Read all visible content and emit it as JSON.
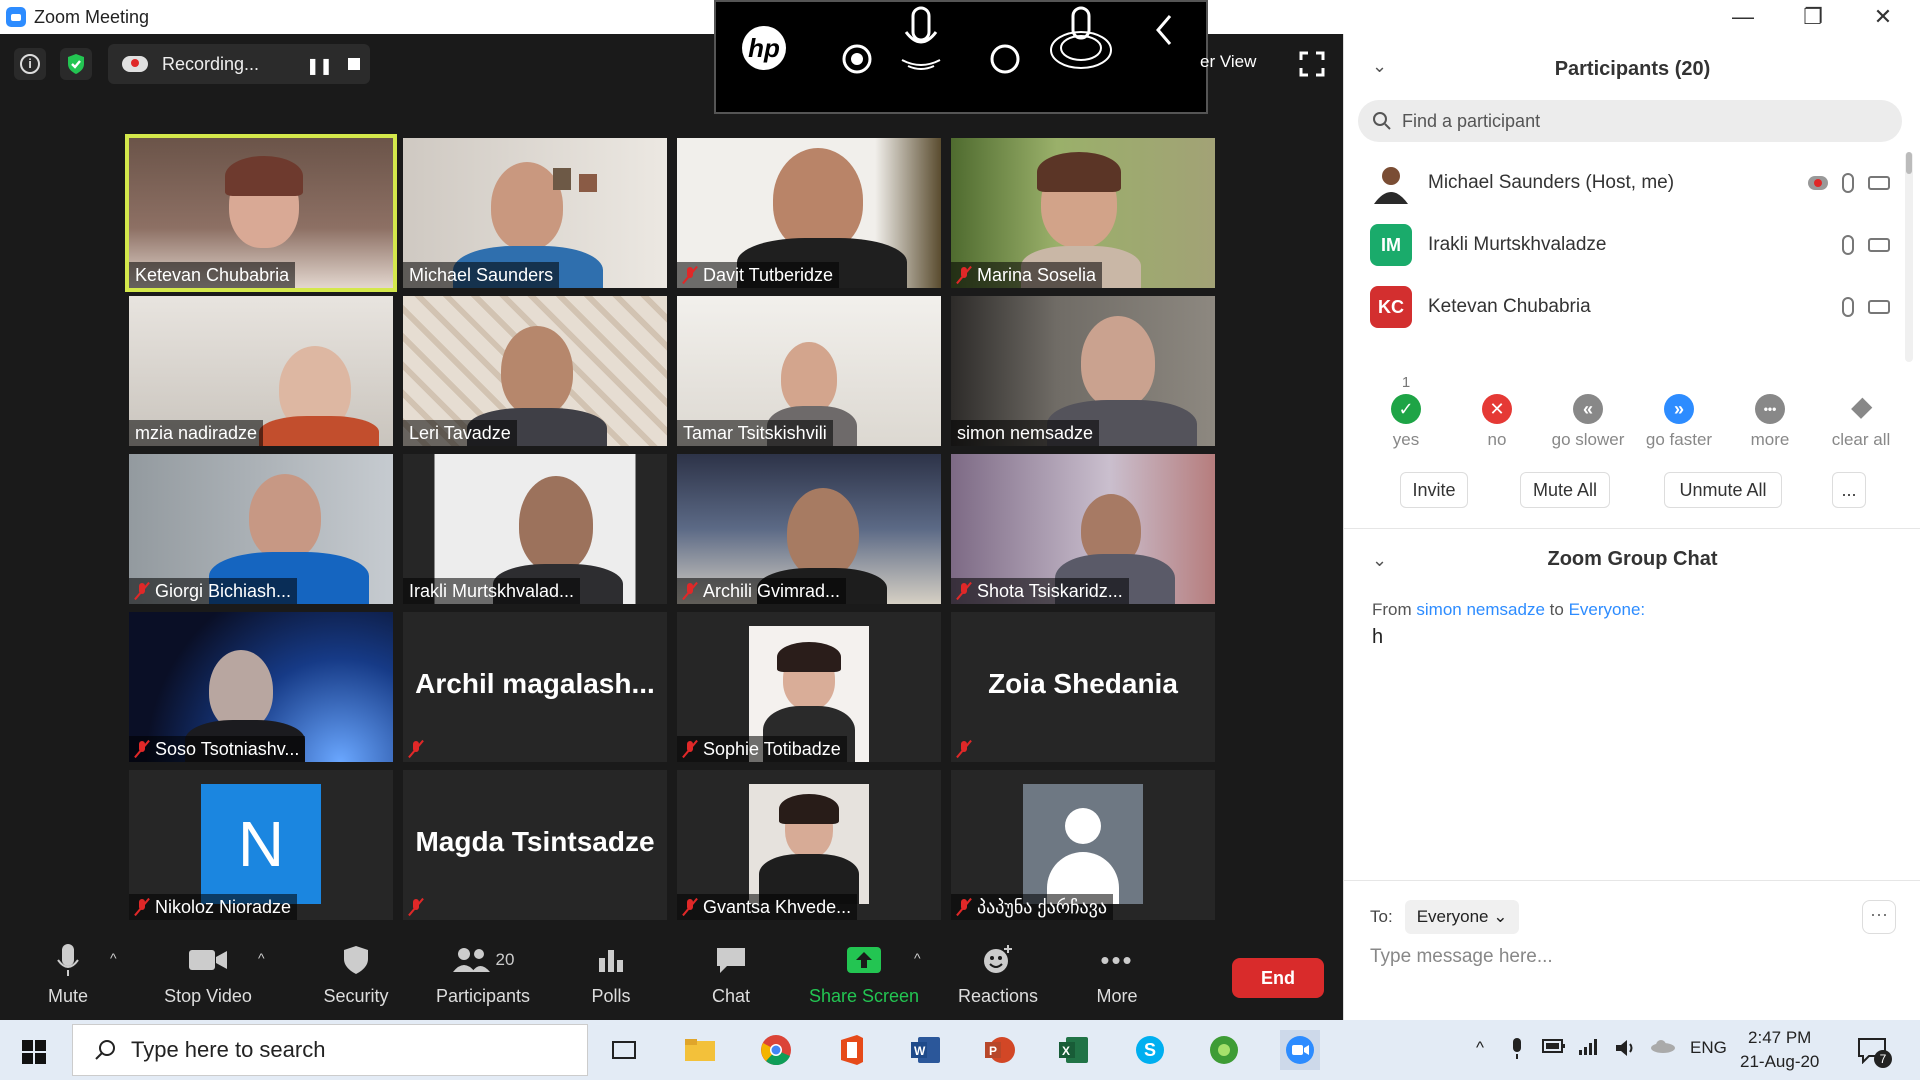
{
  "window": {
    "title": "Zoom Meeting"
  },
  "topbar": {
    "recording_label": "Recording...",
    "view_label": "er View",
    "hp_logo": "hp"
  },
  "tiles": [
    {
      "name": "Ketevan Chubabria"
    },
    {
      "name": "Michael Saunders"
    },
    {
      "name": "Davit Tutberidze"
    },
    {
      "name": "Marina Soselia"
    },
    {
      "name": "mzia nadiradze"
    },
    {
      "name": "Leri Tavadze"
    },
    {
      "name": "Tamar Tsitskishvili"
    },
    {
      "name": "simon nemsadze"
    },
    {
      "name": "Giorgi Bichiash..."
    },
    {
      "name": "Irakli Murtskhvalad..."
    },
    {
      "name": "Archili Gvimrad..."
    },
    {
      "name": "Shota Tsiskaridz..."
    },
    {
      "name": "Soso Tsotniashv..."
    },
    {
      "name": "Archil  magalash..."
    },
    {
      "name": "Sophie Totibadze"
    },
    {
      "name": "Zoia Shedania"
    },
    {
      "name": "Nikoloz Nioradze",
      "initial": "N"
    },
    {
      "name": "Magda Tsintsadze"
    },
    {
      "name": "Gvantsa Khvede..."
    },
    {
      "name": "პაპუნა ქარჩავა"
    }
  ],
  "toolbar": {
    "mute": "Mute",
    "stop_video": "Stop Video",
    "security": "Security",
    "participants": "Participants",
    "participants_count": "20",
    "polls": "Polls",
    "chat": "Chat",
    "share_screen": "Share Screen",
    "reactions": "Reactions",
    "more": "More",
    "end": "End"
  },
  "panel": {
    "title": "Participants (20)",
    "search_placeholder": "Find a participant",
    "participants": [
      {
        "name": "Michael Saunders (Host, me)",
        "initials": ""
      },
      {
        "name": "Irakli Murtskhvaladze",
        "initials": "IM",
        "color": "#1aab6b"
      },
      {
        "name": "Ketevan Chubabria",
        "initials": "KC",
        "color": "#d32f2f"
      }
    ],
    "reactions": [
      {
        "label": "yes",
        "count": "1",
        "color": "#1ea446",
        "icon": "✓"
      },
      {
        "label": "no",
        "count": "",
        "color": "#e53935",
        "icon": "✕"
      },
      {
        "label": "go slower",
        "count": "",
        "color": "#888888",
        "icon": "«"
      },
      {
        "label": "go faster",
        "count": "",
        "color": "#2d8cff",
        "icon": "»"
      },
      {
        "label": "more",
        "count": "",
        "color": "#888888",
        "icon": "•••"
      },
      {
        "label": "clear all",
        "count": "",
        "color": "#888888",
        "icon": ""
      }
    ],
    "buttons": {
      "invite": "Invite",
      "mute_all": "Mute All",
      "unmute_all": "Unmute All",
      "more": "..."
    },
    "chat": {
      "title": "Zoom Group Chat",
      "from_prefix": "From",
      "from_name": "simon nemsadze",
      "to_word": "to",
      "to_name": "Everyone:",
      "message": "h",
      "to_label": "To:",
      "to_value": "Everyone",
      "input_placeholder": "Type message here...",
      "more": "···"
    }
  },
  "taskbar": {
    "search_placeholder": "Type here to search",
    "lang": "ENG",
    "time": "2:47 PM",
    "date": "21-Aug-20",
    "notifications": "7"
  }
}
